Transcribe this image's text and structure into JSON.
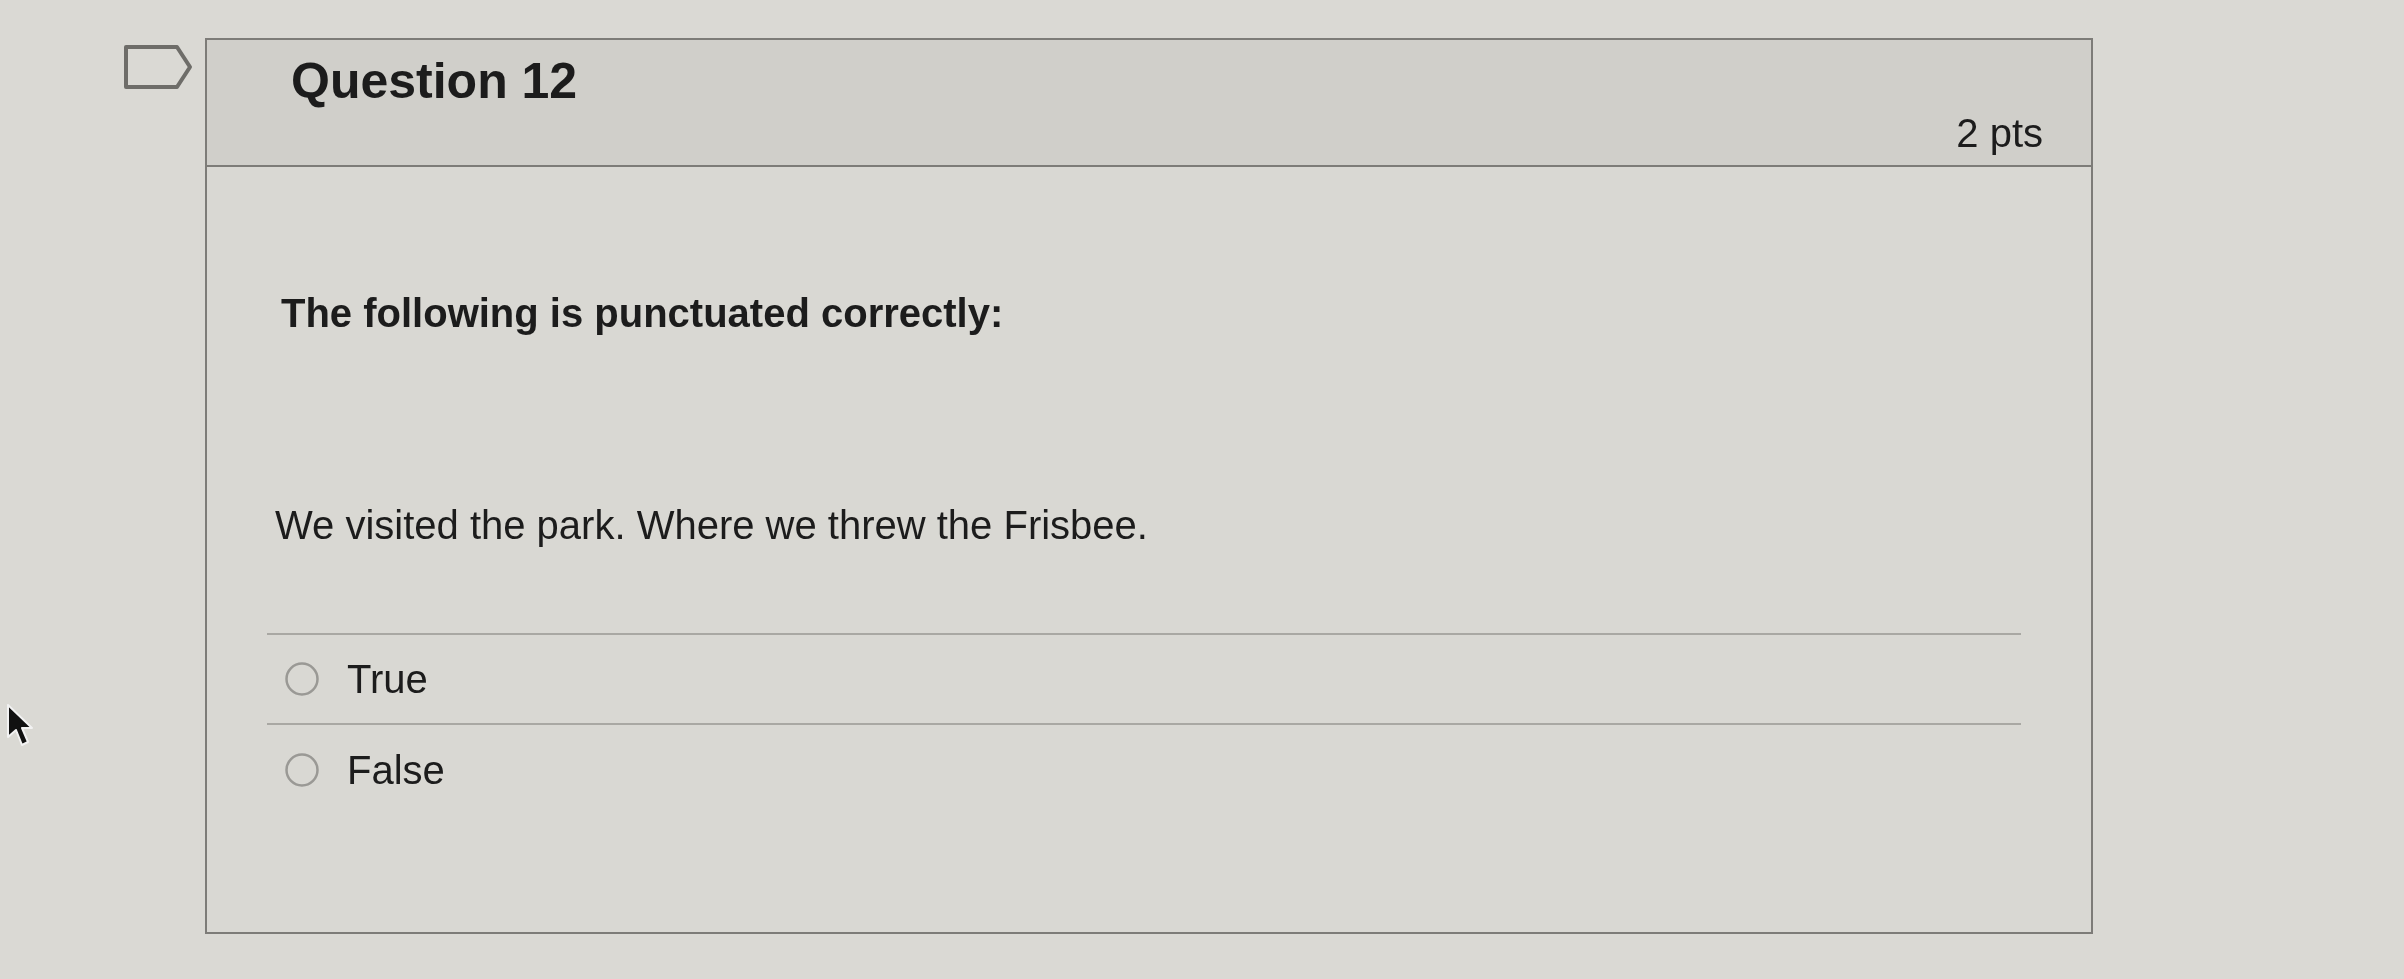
{
  "question": {
    "title": "Question 12",
    "points": "2 pts",
    "prompt": "The following is punctuated correctly:",
    "sentence": "We visited the park. Where we threw the Frisbee.",
    "answers": [
      {
        "label": "True",
        "selected": false
      },
      {
        "label": "False",
        "selected": false
      }
    ]
  }
}
